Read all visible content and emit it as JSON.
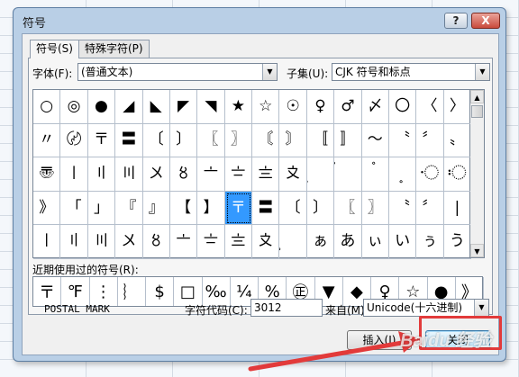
{
  "dialog": {
    "title": "符号",
    "help_label": "?",
    "close_label": "X"
  },
  "tabs": [
    {
      "label": "符号(S)",
      "active": true
    },
    {
      "label": "特殊字符(P)",
      "active": false
    }
  ],
  "font_label": "字体(F):",
  "font_value": "(普通文本)",
  "subset_label": "子集(U):",
  "subset_value": "CJK 符号和标点",
  "symbol_grid": [
    [
      "○",
      "◎",
      "●",
      "◢",
      "◣",
      "◤",
      "◥",
      "★",
      "☆",
      "☉",
      "♀",
      "♂",
      "〆",
      "〇",
      "〈",
      "〉"
    ],
    [
      "〃",
      "〄",
      "〒",
      "〓",
      "〔",
      "〕",
      "〖",
      "〗",
      "〘",
      "〙",
      "〚",
      "〛",
      "〜",
      "〝",
      "〞",
      "〟"
    ],
    [
      "〠",
      "〡",
      "〢",
      "〣",
      "〤",
      "〥",
      "〦",
      "〧",
      "〨",
      "〩",
      "〪",
      "〫",
      "〬",
      "〭",
      "〮",
      "〯"
    ],
    [
      "》",
      "「",
      "」",
      "『",
      "』",
      "【",
      "】",
      "〒",
      "〓",
      "〔",
      "〕",
      "〖",
      "〗",
      "〝",
      "〞",
      "|"
    ],
    [
      "〡",
      "〢",
      "〣",
      "〤",
      "〥",
      "〦",
      "〧",
      "〨",
      "〩",
      "〪",
      "ぁ",
      "あ",
      "ぃ",
      "い",
      "ぅ",
      "う"
    ]
  ],
  "selected_symbol": "〒",
  "recent_label": "近期使用过的符号(R):",
  "recent_symbols": [
    "〒",
    "℉",
    "⋮",
    "︴",
    "$",
    "□",
    "‰",
    "¼",
    "%",
    "㊣",
    "▼",
    "◆",
    "♀",
    "☆",
    "●",
    "》"
  ],
  "char_name": "POSTAL MARK",
  "char_code_label": "字符代码(C):",
  "char_code_value": "3012",
  "from_label": "来自(M):",
  "from_value": "Unicode(十六进制)",
  "insert_button": "插入(I)",
  "close_button": "关闭",
  "watermark_text": "Baidu 经验",
  "colors": {
    "selection": "#3399ff",
    "highlight": "#e23a3a"
  }
}
